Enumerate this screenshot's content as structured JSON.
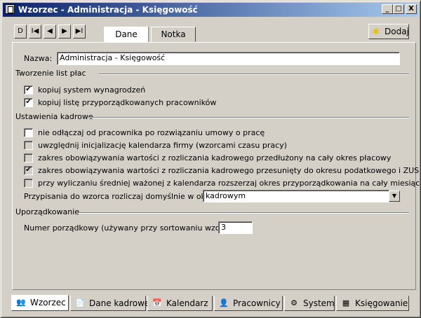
{
  "window": {
    "title": "Wzorzec - Administracja - Księgowość"
  },
  "titlebar_buttons": {
    "minimize": "_",
    "maximize": "□",
    "close": "X"
  },
  "nav": {
    "first": "D",
    "prev_first": "I◀",
    "prev": "◀",
    "next": "▶",
    "last": "▶I"
  },
  "tabs": [
    {
      "label": "Dane",
      "active": true
    },
    {
      "label": "Notka",
      "active": false
    }
  ],
  "add_button": {
    "label": "Dodaj"
  },
  "form": {
    "name_label": "Nazwa:",
    "name_value": "Administracja - Księgowość",
    "sections": {
      "payroll": "Tworzenie list płac",
      "hr": "Ustawienia kadrowe",
      "order": "Uporządkowanie"
    },
    "payroll_options": [
      {
        "label": "kopiuj system wynagrodzeń",
        "checked": true,
        "enabled": true
      },
      {
        "label": "kopiuj listę przyporządkowanych pracowników",
        "checked": true,
        "enabled": true
      }
    ],
    "hr_options": [
      {
        "label": "nie odłączaj od pracownika po rozwiązaniu umowy o pracę",
        "checked": false,
        "enabled": true
      },
      {
        "label": "uwzględnij inicjalizację kalendarza firmy (wzorcami czasu pracy)",
        "checked": false,
        "enabled": false
      },
      {
        "label": "zakres obowiązywania wartości z rozliczania kadrowego przedłużony na cały okres płacowy",
        "checked": false,
        "enabled": false
      },
      {
        "label": "zakres obowiązywania wartości z rozliczania kadrowego przesunięty do okresu podatkowego i ZUS",
        "checked": true,
        "enabled": false
      },
      {
        "label": "przy wyliczaniu średniej ważonej z kalendarza rozszerzaj okres przyporządkowania na cały miesiąc",
        "checked": false,
        "enabled": false
      }
    ],
    "assign_label": "Przypisania do wzorca rozliczaj domyślnie w okresie:",
    "assign_value": "kadrowym",
    "order_label": "Numer porządkowy (używany przy sortowaniu wzorców):",
    "order_value": "3"
  },
  "bottom_tabs": [
    {
      "label": "Wzorzec",
      "icon": "people-icon",
      "active": true
    },
    {
      "label": "Dane kadrowe",
      "icon": "document-icon",
      "active": false
    },
    {
      "label": "Kalendarz",
      "icon": "calendar-icon",
      "active": false
    },
    {
      "label": "Pracownicy",
      "icon": "employees-icon",
      "active": false
    },
    {
      "label": "System",
      "icon": "system-icon",
      "active": false
    },
    {
      "label": "Księgowanie",
      "icon": "ledger-icon",
      "active": false
    }
  ]
}
